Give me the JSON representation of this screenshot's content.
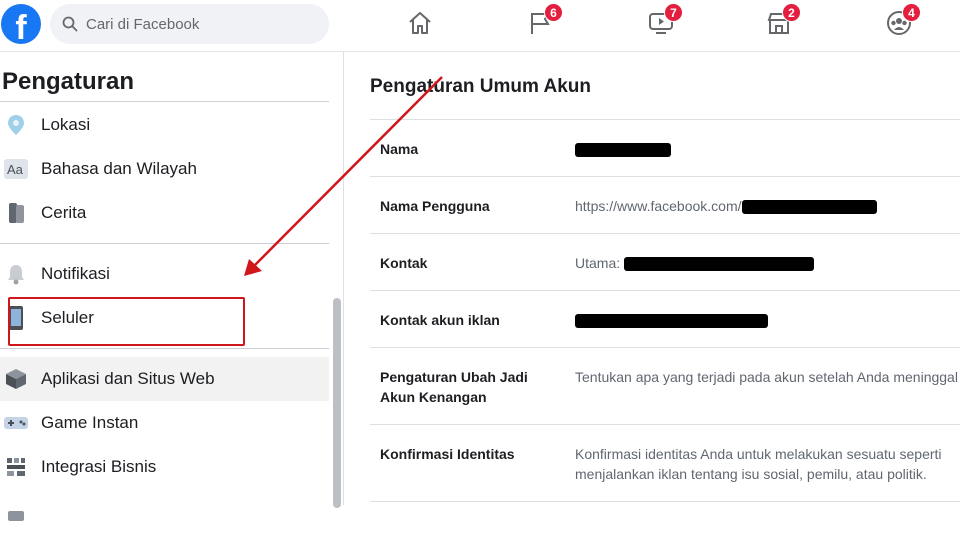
{
  "topbar": {
    "logo_letter": "f",
    "search_placeholder": "Cari di Facebook",
    "nav": [
      {
        "name": "home-icon",
        "badge": ""
      },
      {
        "name": "pages-flag-icon",
        "badge": "6"
      },
      {
        "name": "watch-video-icon",
        "badge": "7"
      },
      {
        "name": "marketplace-icon",
        "badge": "2"
      },
      {
        "name": "groups-icon",
        "badge": "4"
      }
    ]
  },
  "sidebar": {
    "title": "Pengaturan",
    "items": [
      {
        "label": "Lokasi",
        "icon": "location-pin-icon"
      },
      {
        "label": "Bahasa dan Wilayah",
        "icon": "language-aa-icon"
      },
      {
        "label": "Cerita",
        "icon": "story-book-icon"
      },
      {
        "label": "Notifikasi",
        "icon": "bell-icon"
      },
      {
        "label": "Seluler",
        "icon": "mobile-phone-icon"
      },
      {
        "label": "Aplikasi dan Situs Web",
        "icon": "cube-icon"
      },
      {
        "label": "Game Instan",
        "icon": "gamepad-icon"
      },
      {
        "label": "Integrasi Bisnis",
        "icon": "business-integration-icon"
      }
    ]
  },
  "main": {
    "title": "Pengaturan Umum Akun",
    "rows": [
      {
        "label": "Nama",
        "value": ""
      },
      {
        "label": "Nama Pengguna",
        "value": "https://www.facebook.com/"
      },
      {
        "label": "Kontak",
        "value": "Utama: "
      },
      {
        "label": "Kontak akun iklan",
        "value": ""
      },
      {
        "label": "Pengaturan Ubah Jadi Akun Kenangan",
        "value": "Tentukan apa yang terjadi pada akun setelah Anda meninggal dunia."
      },
      {
        "label": "Konfirmasi Identitas",
        "value": "Konfirmasi identitas Anda untuk melakukan sesuatu seperti menjalankan iklan tentang isu sosial, pemilu, atau politik."
      }
    ]
  },
  "colors": {
    "brand": "#1877f2",
    "badge": "#e41e3f",
    "annotation": "#d0161b"
  }
}
